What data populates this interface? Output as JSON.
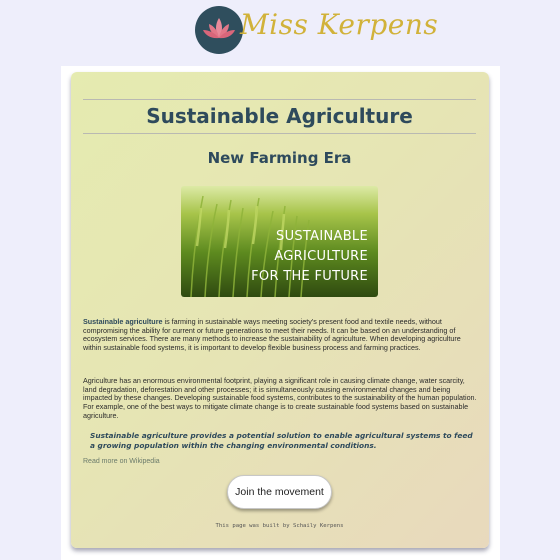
{
  "brand": {
    "logo_text": "Miss Kerpens",
    "logo_icon": "lotus-icon",
    "colors": {
      "logo_circle": "#2f4e5d",
      "logo_text": "#d1b23a",
      "heading": "#2e4a5c"
    }
  },
  "article": {
    "title": "Sustainable Agriculture",
    "subtitle": "New Farming Era",
    "hero_image": {
      "line1": "SUSTAINABLE",
      "line2": "AGRICULTURE",
      "line3": "FOR THE FUTURE"
    },
    "para1_lead": "Sustainable agriculture",
    "para1_rest": " is farming in sustainable ways meeting society's present food and textile needs, without compromising the ability for current or future generations to meet their needs. It can be based on an understanding of ecosystem services. There are many methods to increase the sustainability of agriculture. When developing agriculture within sustainable food systems, it is important to develop flexible business process and farming practices.",
    "para2": "Agriculture has an enormous environmental footprint, playing a significant role in causing climate change, water scarcity, land degradation, deforestation and other processes; it is simultaneously causing environmental changes and being impacted by these changes. Developing sustainable food systems, contributes to the sustainability of the human population. For example, one of the best ways to mitigate climate change is to create sustainable food systems based on sustainable agriculture.",
    "quote": "Sustainable agriculture provides a potential solution to enable agricultural systems to feed a growing population within the changing environmental conditions.",
    "wiki_link": "Read more on Wikipedia",
    "cta_label": "Join the movement",
    "footer": "This page was built by Schaily Kerpens"
  }
}
